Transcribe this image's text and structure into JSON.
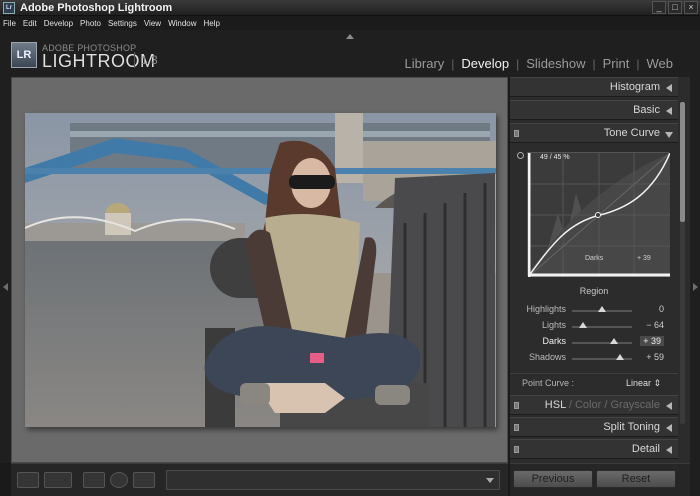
{
  "window": {
    "title": "Adobe Photoshop Lightroom",
    "icon_text": "Lr"
  },
  "menu": [
    "File",
    "Edit",
    "Develop",
    "Photo",
    "Settings",
    "View",
    "Window",
    "Help"
  ],
  "brand": {
    "badge": "LR",
    "top": "ADOBE PHOTOSHOP",
    "main": "LIGHTROOM",
    "version": "1.3"
  },
  "modules": [
    {
      "label": "Library",
      "active": false
    },
    {
      "label": "Develop",
      "active": true
    },
    {
      "label": "Slideshow",
      "active": false
    },
    {
      "label": "Print",
      "active": false
    },
    {
      "label": "Web",
      "active": false
    }
  ],
  "panels": {
    "histogram": "Histogram",
    "basic": "Basic",
    "tone_curve": "Tone Curve",
    "hsl": {
      "hsl": "HSL",
      "color": "Color",
      "grayscale": "Grayscale"
    },
    "split_toning": "Split Toning",
    "detail": "Detail"
  },
  "tone_curve": {
    "readout": "49 / 45 %",
    "region_title": "Region",
    "active_caption": "Darks",
    "active_value": "+ 39",
    "sliders": [
      {
        "name": "Highlights",
        "value": "0",
        "level": 0.5,
        "active": false
      },
      {
        "name": "Lights",
        "value": "− 64",
        "level": 0.18,
        "active": false
      },
      {
        "name": "Darks",
        "value": "+ 39",
        "level": 0.7,
        "active": true
      },
      {
        "name": "Shadows",
        "value": "+ 59",
        "level": 0.8,
        "active": false
      }
    ],
    "point_curve_label": "Point Curve :",
    "point_curve_value": "Linear ⇕"
  },
  "buttons": {
    "previous": "Previous",
    "reset": "Reset"
  },
  "window_controls": {
    "minimize": "_",
    "maximize": "□",
    "close": "×"
  }
}
